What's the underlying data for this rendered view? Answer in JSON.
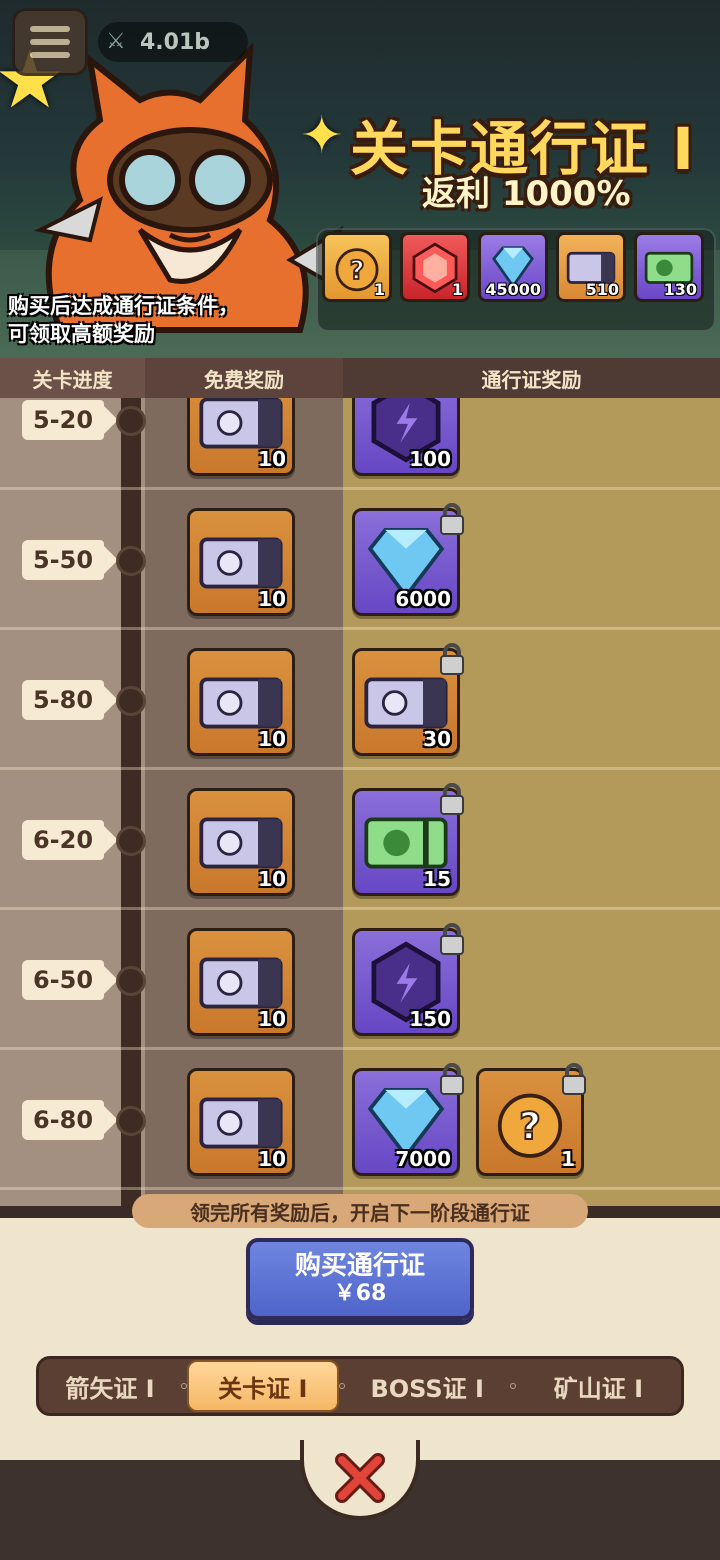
{
  "header": {
    "resource_value": "4.01b",
    "title": "关卡通行证 I",
    "subtitle": "返利 1000%",
    "desc_line1": "购买后达成通行证条件，",
    "desc_line2": "可领取高额奖励"
  },
  "promo_items": [
    {
      "icon": "mystery-hero-icon",
      "count": "1"
    },
    {
      "icon": "red-gem-icon",
      "count": "1"
    },
    {
      "icon": "diamond-icon",
      "count": "45000"
    },
    {
      "icon": "summon-ticket-icon",
      "count": "510"
    },
    {
      "icon": "green-ticket-icon",
      "count": "130"
    }
  ],
  "columns": {
    "progress": "关卡进度",
    "free": "免费奖励",
    "pass": "通行证奖励"
  },
  "rows": [
    {
      "stage": "5-20",
      "free": {
        "icon": "summon-ticket-icon",
        "count": "10"
      },
      "pass": [
        {
          "icon": "purple-shard-icon",
          "count": "100",
          "locked": false
        }
      ]
    },
    {
      "stage": "5-50",
      "free": {
        "icon": "summon-ticket-icon",
        "count": "10"
      },
      "pass": [
        {
          "icon": "diamond-icon",
          "count": "6000",
          "locked": true
        }
      ]
    },
    {
      "stage": "5-80",
      "free": {
        "icon": "summon-ticket-icon",
        "count": "10"
      },
      "pass": [
        {
          "icon": "summon-ticket-icon",
          "count": "30",
          "locked": true
        }
      ]
    },
    {
      "stage": "6-20",
      "free": {
        "icon": "summon-ticket-icon",
        "count": "10"
      },
      "pass": [
        {
          "icon": "green-ticket-icon",
          "count": "15",
          "locked": true
        }
      ]
    },
    {
      "stage": "6-50",
      "free": {
        "icon": "summon-ticket-icon",
        "count": "10"
      },
      "pass": [
        {
          "icon": "purple-shard-icon",
          "count": "150",
          "locked": true
        }
      ]
    },
    {
      "stage": "6-80",
      "free": {
        "icon": "summon-ticket-icon",
        "count": "10"
      },
      "pass": [
        {
          "icon": "diamond-icon",
          "count": "7000",
          "locked": true
        },
        {
          "icon": "mystery-hero-icon",
          "count": "1",
          "locked": true
        }
      ]
    }
  ],
  "footer": {
    "notice": "领完所有奖励后，开启下一阶段通行证",
    "buy_label": "购买通行证",
    "price": "￥68"
  },
  "tabs": [
    {
      "label": "箭矢证 I",
      "active": false
    },
    {
      "label": "关卡证 I",
      "active": true
    },
    {
      "label": "BOSS证 I",
      "active": false
    },
    {
      "label": "矿山证 I",
      "active": false
    }
  ],
  "colors": {
    "title": "#ffd85e",
    "accent_blue": "#5b70d2",
    "active_tab": "#f5b766",
    "close": "#d8382f"
  }
}
